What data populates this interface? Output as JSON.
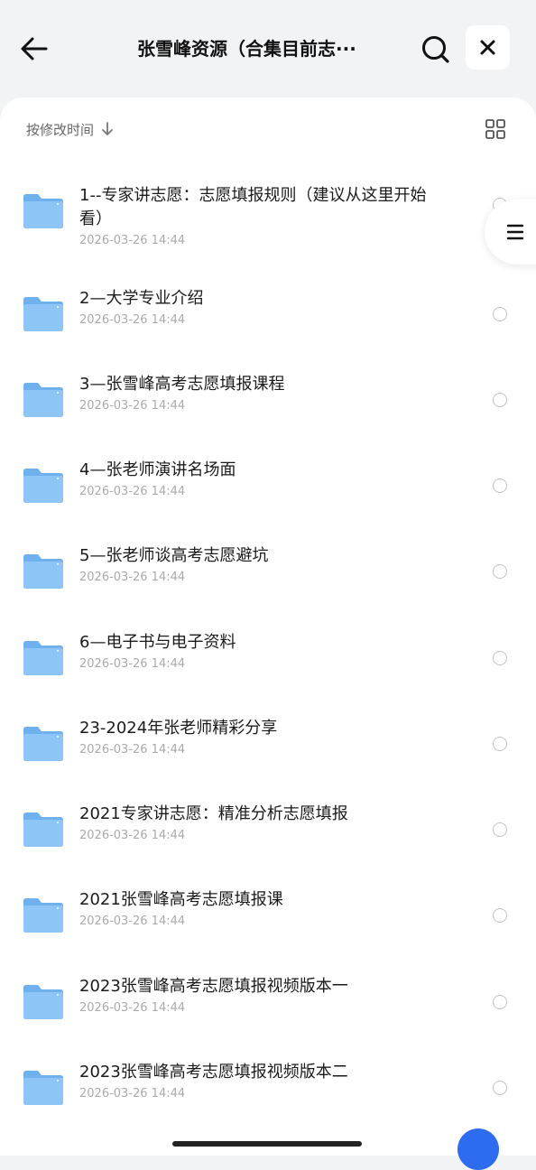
{
  "header": {
    "title": "张雪峰资源（合集目前志···",
    "back_icon": "arrow-left-icon",
    "search_icon": "search-icon",
    "close_icon": "close-icon"
  },
  "toolbar": {
    "sort_label": "按修改时间",
    "sort_icon": "arrow-down-icon",
    "view_icon": "grid-view-icon"
  },
  "colors": {
    "folder": "#8ec5f7",
    "folder_dark": "#6fb0ef",
    "background": "#f2f3f5",
    "accent": "#2d6bf0"
  },
  "files": [
    {
      "name": "1--专家讲志愿：志愿填报规则（建议从这里开始看）",
      "date": "2026-03-26 14:44"
    },
    {
      "name": "2—大学专业介绍",
      "date": "2026-03-26 14:44"
    },
    {
      "name": "3—张雪峰高考志愿填报课程",
      "date": "2026-03-26 14:44"
    },
    {
      "name": "4—张老师演讲名场面",
      "date": "2026-03-26 14:44"
    },
    {
      "name": "5—张老师谈高考志愿避坑",
      "date": "2026-03-26 14:44"
    },
    {
      "name": "6—电子书与电子资料",
      "date": "2026-03-26 14:44"
    },
    {
      "name": "23-2024年张老师精彩分享",
      "date": "2026-03-26 14:44"
    },
    {
      "name": "2021专家讲志愿：精准分析志愿填报",
      "date": "2026-03-26 14:44"
    },
    {
      "name": "2021张雪峰高考志愿填报课",
      "date": "2026-03-26 14:44"
    },
    {
      "name": "2023张雪峰高考志愿填报视频版本一",
      "date": "2026-03-26 14:44"
    },
    {
      "name": "2023张雪峰高考志愿填报视频版本二",
      "date": "2026-03-26 14:44"
    }
  ],
  "side_menu": {
    "icon": "menu-icon"
  }
}
